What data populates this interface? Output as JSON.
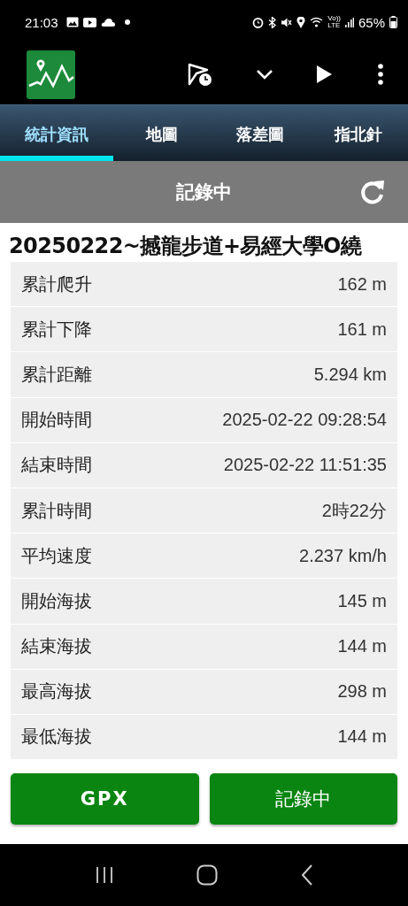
{
  "status_bar": {
    "time": "21:03",
    "network_top": "Vo))",
    "network_bottom": "LTE",
    "battery": "65%"
  },
  "tabs": [
    {
      "label": "統計資訊",
      "selected": true
    },
    {
      "label": "地圖",
      "selected": false
    },
    {
      "label": "落差圖",
      "selected": false
    },
    {
      "label": "指北針",
      "selected": false
    }
  ],
  "status_header": {
    "title": "記錄中"
  },
  "track_title": "20250222~撼龍步道+易經大學O繞",
  "stats": [
    {
      "label": "累計爬升",
      "value": "162 m"
    },
    {
      "label": "累計下降",
      "value": "161 m"
    },
    {
      "label": "累計距離",
      "value": "5.294 km"
    },
    {
      "label": "開始時間",
      "value": "2025-02-22 09:28:54"
    },
    {
      "label": "結束時間",
      "value": "2025-02-22 11:51:35"
    },
    {
      "label": "累計時間",
      "value": "2時22分"
    },
    {
      "label": "平均速度",
      "value": "2.237 km/h"
    },
    {
      "label": "開始海拔",
      "value": "145 m"
    },
    {
      "label": "結束海拔",
      "value": "144 m"
    },
    {
      "label": "最高海拔",
      "value": "298 m"
    },
    {
      "label": "最低海拔",
      "value": "144 m"
    }
  ],
  "buttons": [
    "GPX",
    "記錄中"
  ]
}
